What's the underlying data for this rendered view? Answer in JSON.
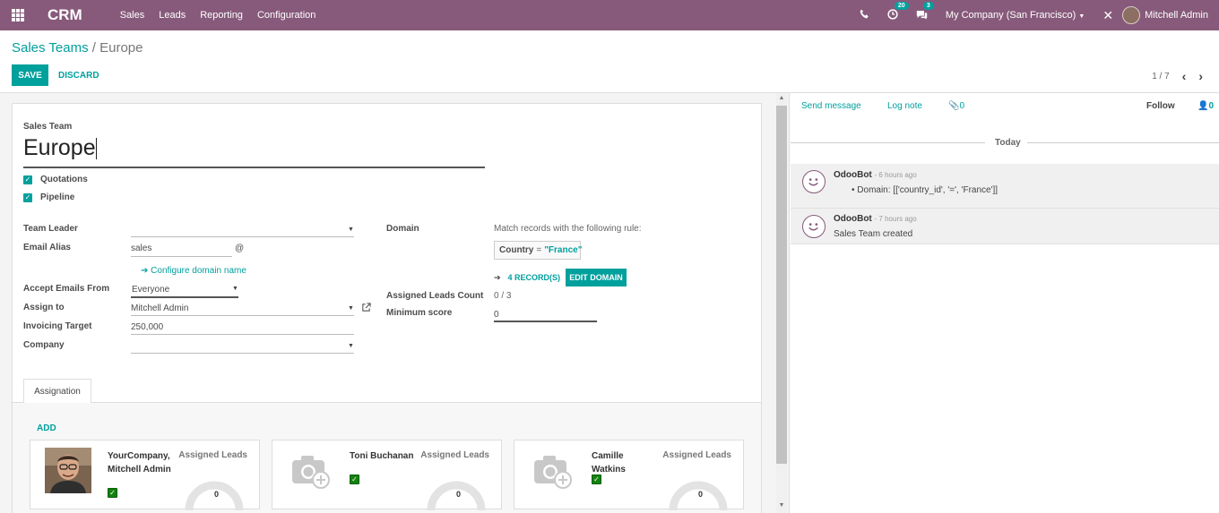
{
  "navbar": {
    "app_name": "CRM",
    "menu": [
      "Sales",
      "Leads",
      "Reporting",
      "Configuration"
    ],
    "activity_count": "20",
    "message_count": "3",
    "company": "My Company (San Francisco)",
    "user": "Mitchell Admin",
    "colors": {
      "brand": "#875a7b",
      "accent": "#00a09d"
    }
  },
  "breadcrumb": {
    "parent": "Sales Teams",
    "separator": "/",
    "current": "Europe"
  },
  "actions": {
    "save": "SAVE",
    "discard": "DISCARD"
  },
  "pager": {
    "value": "1 / 7"
  },
  "form": {
    "team_label": "Sales Team",
    "team_name": "Europe",
    "checkboxes": [
      {
        "label": "Quotations",
        "checked": true
      },
      {
        "label": "Pipeline",
        "checked": true
      }
    ],
    "team_leader_label": "Team Leader",
    "team_leader_value": "",
    "email_alias_label": "Email Alias",
    "email_alias_value": "sales",
    "email_at": "@",
    "configure_domain": "Configure domain name",
    "accept_from_label": "Accept Emails From",
    "accept_from_value": "Everyone",
    "assign_to_label": "Assign to",
    "assign_to_value": "Mitchell Admin",
    "invoicing_label": "Invoicing Target",
    "invoicing_value": "250,000",
    "company_label": "Company",
    "company_value": "",
    "domain_label": "Domain",
    "domain_rule_text": "Match records with the following rule:",
    "domain_field": "Country",
    "domain_op": "=",
    "domain_value": "\"France\"",
    "records_link": "4 RECORD(S)",
    "edit_domain": "EDIT DOMAIN",
    "assigned_count_label": "Assigned Leads Count",
    "assigned_count_value": "0 / 3",
    "min_score_label": "Minimum score",
    "min_score_value": "0"
  },
  "tabs": {
    "assignation": "Assignation",
    "add": "ADD"
  },
  "members": [
    {
      "name": "YourCompany, Mitchell Admin",
      "leads_label": "Assigned Leads",
      "leads_value": "0"
    },
    {
      "name": "Toni Buchanan",
      "leads_label": "Assigned Leads",
      "leads_value": "0"
    },
    {
      "name": "Camille Watkins",
      "leads_label": "Assigned Leads",
      "leads_value": "0"
    }
  ],
  "chatter": {
    "send_message": "Send message",
    "log_note": "Log note",
    "attachments": "0",
    "follow": "Follow",
    "followers": "0",
    "date_separator": "Today",
    "messages": [
      {
        "author": "OdooBot",
        "time": "- 6 hours ago",
        "body": "Domain: [['country_id', '=', 'France']]"
      },
      {
        "author": "OdooBot",
        "time": "- 7 hours ago",
        "body": "Sales Team created"
      }
    ]
  }
}
